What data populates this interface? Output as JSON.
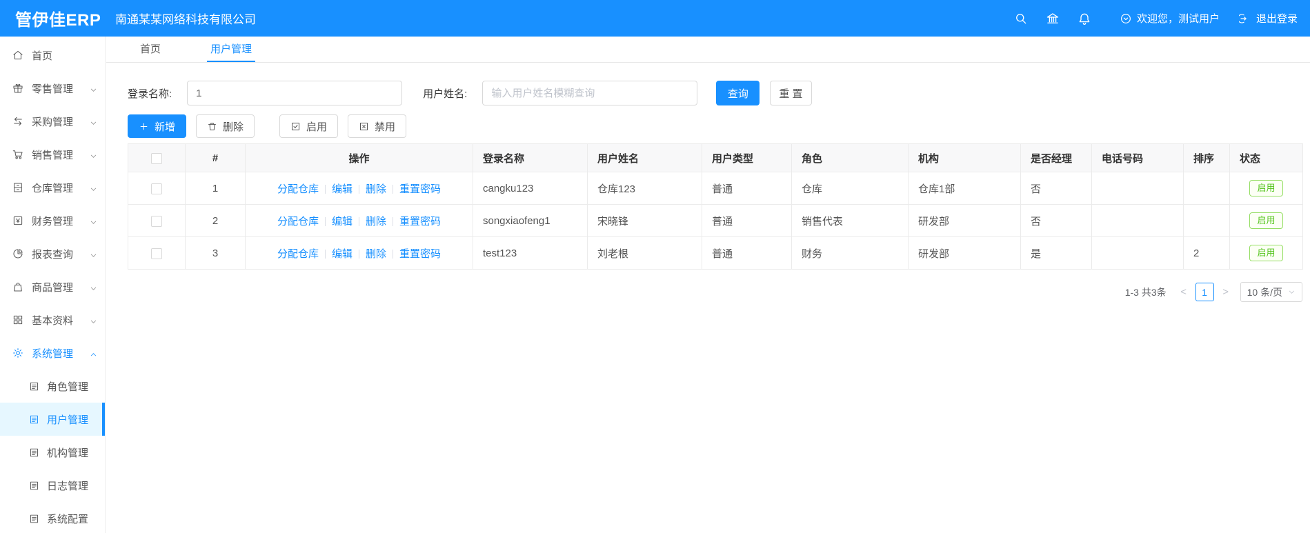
{
  "colors": {
    "primary": "#1890ff",
    "active_item_bg": "#e6f7ff",
    "status_green": "#52c41a"
  },
  "header": {
    "logo": "管伊佳ERP",
    "company": "南通某某网络科技有限公司",
    "welcome": "欢迎您，测试用户",
    "logout": "退出登录"
  },
  "tabs": {
    "home": "首页",
    "current": "用户管理"
  },
  "sidebar": {
    "items": [
      {
        "label": "首页",
        "icon": "home-icon"
      },
      {
        "label": "零售管理",
        "icon": "gift-icon"
      },
      {
        "label": "采购管理",
        "icon": "swap-icon"
      },
      {
        "label": "销售管理",
        "icon": "cart-icon"
      },
      {
        "label": "仓库管理",
        "icon": "cabinet-icon"
      },
      {
        "label": "财务管理",
        "icon": "money-icon"
      },
      {
        "label": "报表查询",
        "icon": "pie-chart-icon"
      },
      {
        "label": "商品管理",
        "icon": "bag-icon"
      },
      {
        "label": "基本资料",
        "icon": "grid-icon"
      },
      {
        "label": "系统管理",
        "icon": "gear-icon"
      }
    ],
    "system_children": [
      {
        "label": "角色管理"
      },
      {
        "label": "用户管理"
      },
      {
        "label": "机构管理"
      },
      {
        "label": "日志管理"
      },
      {
        "label": "系统配置"
      }
    ]
  },
  "form": {
    "login_label": "登录名称:",
    "login_value": "1",
    "name_label": "用户姓名:",
    "name_placeholder": "输入用户姓名模糊查询",
    "search_button": "查询",
    "reset_button": "重 置"
  },
  "toolbar": {
    "add": "新增",
    "delete": "删除",
    "enable": "启用",
    "disable": "禁用"
  },
  "table": {
    "columns": [
      "",
      "#",
      "操作",
      "登录名称",
      "用户姓名",
      "用户类型",
      "角色",
      "机构",
      "是否经理",
      "电话号码",
      "排序",
      "状态"
    ],
    "action_links": [
      "分配仓库",
      "编辑",
      "删除",
      "重置密码"
    ],
    "rows": [
      {
        "index": "1",
        "login": "cangku123",
        "name": "仓库123",
        "type": "普通",
        "role": "仓库",
        "org": "仓库1部",
        "manager": "否",
        "phone": "",
        "sort": "",
        "status": "启用"
      },
      {
        "index": "2",
        "login": "songxiaofeng1",
        "name": "宋晓锋",
        "type": "普通",
        "role": "销售代表",
        "org": "研发部",
        "manager": "否",
        "phone": "",
        "sort": "",
        "status": "启用"
      },
      {
        "index": "3",
        "login": "test123",
        "name": "刘老根",
        "type": "普通",
        "role": "财务",
        "org": "研发部",
        "manager": "是",
        "phone": "",
        "sort": "2",
        "status": "启用"
      }
    ]
  },
  "pagination": {
    "total": "1-3 共3条",
    "prev": "<",
    "page": "1",
    "next": ">",
    "page_size": "10 条/页"
  }
}
